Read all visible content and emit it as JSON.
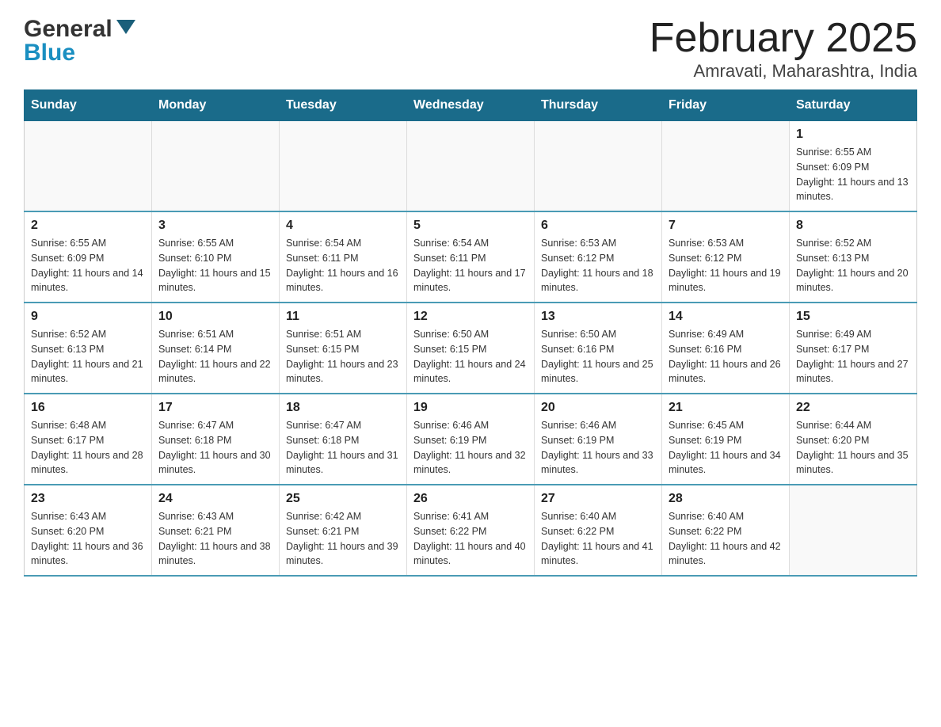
{
  "logo": {
    "general": "General",
    "blue": "Blue"
  },
  "title": "February 2025",
  "subtitle": "Amravati, Maharashtra, India",
  "days_of_week": [
    "Sunday",
    "Monday",
    "Tuesday",
    "Wednesday",
    "Thursday",
    "Friday",
    "Saturday"
  ],
  "weeks": [
    [
      {
        "day": "",
        "info": ""
      },
      {
        "day": "",
        "info": ""
      },
      {
        "day": "",
        "info": ""
      },
      {
        "day": "",
        "info": ""
      },
      {
        "day": "",
        "info": ""
      },
      {
        "day": "",
        "info": ""
      },
      {
        "day": "1",
        "info": "Sunrise: 6:55 AM\nSunset: 6:09 PM\nDaylight: 11 hours and 13 minutes."
      }
    ],
    [
      {
        "day": "2",
        "info": "Sunrise: 6:55 AM\nSunset: 6:09 PM\nDaylight: 11 hours and 14 minutes."
      },
      {
        "day": "3",
        "info": "Sunrise: 6:55 AM\nSunset: 6:10 PM\nDaylight: 11 hours and 15 minutes."
      },
      {
        "day": "4",
        "info": "Sunrise: 6:54 AM\nSunset: 6:11 PM\nDaylight: 11 hours and 16 minutes."
      },
      {
        "day": "5",
        "info": "Sunrise: 6:54 AM\nSunset: 6:11 PM\nDaylight: 11 hours and 17 minutes."
      },
      {
        "day": "6",
        "info": "Sunrise: 6:53 AM\nSunset: 6:12 PM\nDaylight: 11 hours and 18 minutes."
      },
      {
        "day": "7",
        "info": "Sunrise: 6:53 AM\nSunset: 6:12 PM\nDaylight: 11 hours and 19 minutes."
      },
      {
        "day": "8",
        "info": "Sunrise: 6:52 AM\nSunset: 6:13 PM\nDaylight: 11 hours and 20 minutes."
      }
    ],
    [
      {
        "day": "9",
        "info": "Sunrise: 6:52 AM\nSunset: 6:13 PM\nDaylight: 11 hours and 21 minutes."
      },
      {
        "day": "10",
        "info": "Sunrise: 6:51 AM\nSunset: 6:14 PM\nDaylight: 11 hours and 22 minutes."
      },
      {
        "day": "11",
        "info": "Sunrise: 6:51 AM\nSunset: 6:15 PM\nDaylight: 11 hours and 23 minutes."
      },
      {
        "day": "12",
        "info": "Sunrise: 6:50 AM\nSunset: 6:15 PM\nDaylight: 11 hours and 24 minutes."
      },
      {
        "day": "13",
        "info": "Sunrise: 6:50 AM\nSunset: 6:16 PM\nDaylight: 11 hours and 25 minutes."
      },
      {
        "day": "14",
        "info": "Sunrise: 6:49 AM\nSunset: 6:16 PM\nDaylight: 11 hours and 26 minutes."
      },
      {
        "day": "15",
        "info": "Sunrise: 6:49 AM\nSunset: 6:17 PM\nDaylight: 11 hours and 27 minutes."
      }
    ],
    [
      {
        "day": "16",
        "info": "Sunrise: 6:48 AM\nSunset: 6:17 PM\nDaylight: 11 hours and 28 minutes."
      },
      {
        "day": "17",
        "info": "Sunrise: 6:47 AM\nSunset: 6:18 PM\nDaylight: 11 hours and 30 minutes."
      },
      {
        "day": "18",
        "info": "Sunrise: 6:47 AM\nSunset: 6:18 PM\nDaylight: 11 hours and 31 minutes."
      },
      {
        "day": "19",
        "info": "Sunrise: 6:46 AM\nSunset: 6:19 PM\nDaylight: 11 hours and 32 minutes."
      },
      {
        "day": "20",
        "info": "Sunrise: 6:46 AM\nSunset: 6:19 PM\nDaylight: 11 hours and 33 minutes."
      },
      {
        "day": "21",
        "info": "Sunrise: 6:45 AM\nSunset: 6:19 PM\nDaylight: 11 hours and 34 minutes."
      },
      {
        "day": "22",
        "info": "Sunrise: 6:44 AM\nSunset: 6:20 PM\nDaylight: 11 hours and 35 minutes."
      }
    ],
    [
      {
        "day": "23",
        "info": "Sunrise: 6:43 AM\nSunset: 6:20 PM\nDaylight: 11 hours and 36 minutes."
      },
      {
        "day": "24",
        "info": "Sunrise: 6:43 AM\nSunset: 6:21 PM\nDaylight: 11 hours and 38 minutes."
      },
      {
        "day": "25",
        "info": "Sunrise: 6:42 AM\nSunset: 6:21 PM\nDaylight: 11 hours and 39 minutes."
      },
      {
        "day": "26",
        "info": "Sunrise: 6:41 AM\nSunset: 6:22 PM\nDaylight: 11 hours and 40 minutes."
      },
      {
        "day": "27",
        "info": "Sunrise: 6:40 AM\nSunset: 6:22 PM\nDaylight: 11 hours and 41 minutes."
      },
      {
        "day": "28",
        "info": "Sunrise: 6:40 AM\nSunset: 6:22 PM\nDaylight: 11 hours and 42 minutes."
      },
      {
        "day": "",
        "info": ""
      }
    ]
  ]
}
